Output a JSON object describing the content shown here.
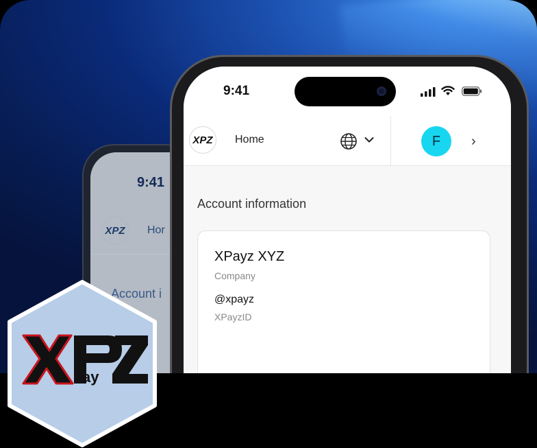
{
  "back_phone": {
    "time": "9:41",
    "logo_text": "XPZ",
    "nav_home_partial": "Hor",
    "account_partial": "Account i"
  },
  "status_bar": {
    "time": "9:41"
  },
  "nav": {
    "logo_text": "XPZ",
    "home_label": "Home",
    "avatar_initial": "F",
    "globe_icon": "globe-icon",
    "chevron_icon": "chevron-down-icon",
    "forward_icon": "chevron-right-icon"
  },
  "account": {
    "title": "Account information",
    "company_name": "XPayz XYZ",
    "company_label": "Company",
    "handle": "@xpayz",
    "handle_label": "XPayzID"
  },
  "colors": {
    "avatar_bg": "#18d6f0",
    "logo_red": "#c8151d",
    "badge_bg": "#b7cde8"
  }
}
